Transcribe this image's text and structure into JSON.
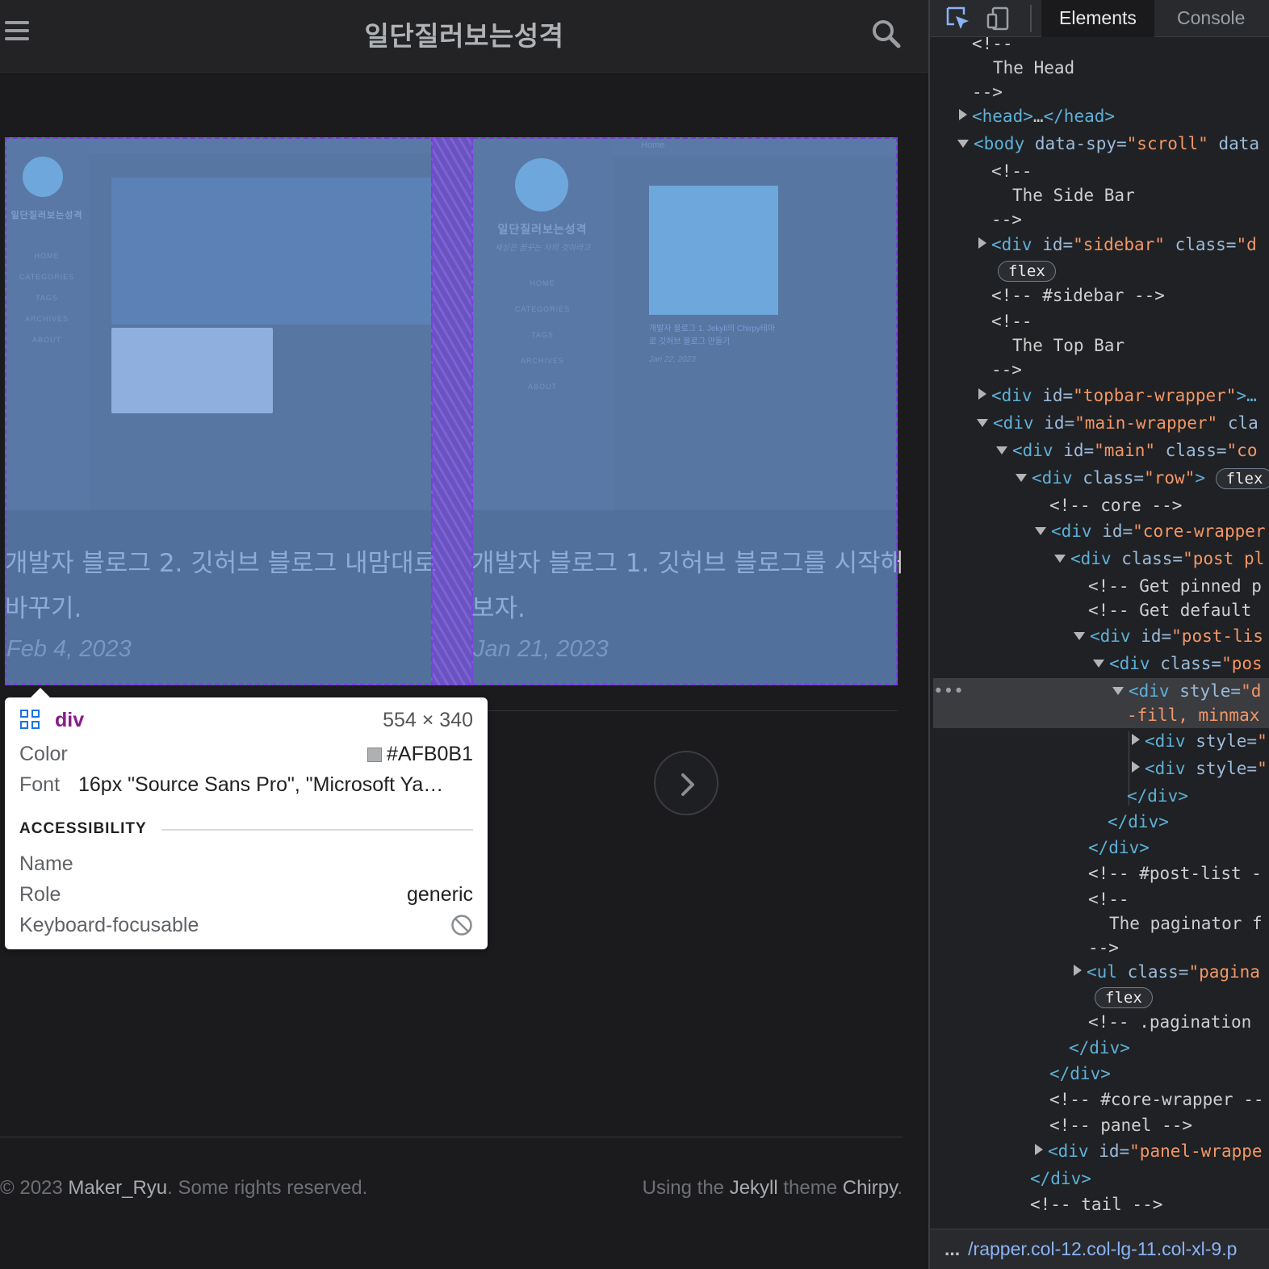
{
  "blog": {
    "site_title": "일단질러보는성격",
    "mini_site_title": "일단질러보는성격",
    "mini_subtitle": "세상은 꿈꾸는 자의 것이라고",
    "mini_nav": [
      "HOME",
      "CATEGORIES",
      "TAGS",
      "ARCHIVES",
      "ABOUT"
    ],
    "mini_home_bar": "Home",
    "mini_post_title": "개발자 블로그 1. Jekyll의 Chirpy테마로 깃허브 블로그 만들기",
    "mini_post_date": "Jan 22, 2023",
    "posts": [
      {
        "title": "개발자 블로그 2. 깃허브 블로그 내맘대로 바꾸기.",
        "date": "Feb 4, 2023"
      },
      {
        "title": "개발자 블로그 1. 깃허브 블로그를 시작해보자.",
        "date": "Jan 21, 2023"
      }
    ],
    "footer": {
      "copyright": "© 2023 ",
      "author": "Maker_Ryu",
      "rights": ". Some rights reserved.",
      "using_prefix": "Using the ",
      "jekyll": "Jekyll",
      "theme_word": " theme ",
      "chirpy": "Chirpy",
      "period": "."
    }
  },
  "tooltip": {
    "tag": "div",
    "dimensions": "554 × 340",
    "color_label": "Color",
    "color_value": "#AFB0B1",
    "font_label": "Font",
    "font_value": "16px \"Source Sans Pro\", \"Microsoft Ya…",
    "accessibility_header": "ACCESSIBILITY",
    "name_label": "Name",
    "role_label": "Role",
    "role_value": "generic",
    "focusable_label": "Keyboard-focusable"
  },
  "devtools": {
    "tabs": [
      "Elements",
      "Console"
    ],
    "active_tab": "Elements",
    "breadcrumb": "/rapper.col-12.col-lg-11.col-xl-9.p",
    "lines": {
      "l0": "<!--",
      "l1": "The Head",
      "l2": "-->",
      "head_tag": "<head>",
      "head_dots": "…",
      "head_close": "</head>",
      "body_tag": "<body",
      "body_attr1": " data-spy=",
      "body_val1": "\"scroll\"",
      "body_attr2": " data",
      "c_open": "<!--",
      "side_bar": "The Side Bar",
      "c_close": "-->",
      "sidebar_div": "<div",
      "sidebar_id": " id=",
      "sidebar_id_val": "\"sidebar\"",
      "sidebar_class": " class=",
      "sidebar_class_val": "\"d",
      "flex": "flex",
      "sidebar_end": "<!-- #sidebar -->",
      "top_bar": "The Top Bar",
      "topbar_div": "<div",
      "topbar_id": " id=",
      "topbar_val": "\"topbar-wrapper\"",
      "topbar_end": ">…",
      "main_wrapper_div": "<div",
      "main_wrapper_id": " id=",
      "main_wrapper_val": "\"main-wrapper\"",
      "main_wrapper_cls": " cla",
      "main_div": "<div",
      "main_id": " id=",
      "main_val": "\"main\"",
      "main_cls": " class=",
      "main_cls_val": "\"co",
      "row_div": "<div",
      "row_cls": " class=",
      "row_val": "\"row\"",
      "row_end": ">",
      "core_comment": "<!-- core -->",
      "core_div": "<div",
      "core_id": " id=",
      "core_val": "\"core-wrapper",
      "post_div": "<div",
      "post_cls": " class=",
      "post_val": "\"post pl",
      "pinned": "<!-- Get pinned p",
      "default": "<!-- Get default ",
      "postlist_div": "<div",
      "postlist_id": " id=",
      "postlist_val": "\"post-lis",
      "pos_div": "<div",
      "pos_cls": " class=",
      "pos_val": "\"pos",
      "sel_div": "<div",
      "sel_style": " style=",
      "sel_val": "\"d",
      "sel_cont": "-fill, minmax",
      "child1_div": "<div",
      "child1_style": " style=",
      "child1_val": "\"",
      "child2_div": "<div",
      "child2_style": " style=",
      "child2_val": "\"",
      "close_div": "</div>",
      "postlist_end": "<!-- #post-list -",
      "paginator": "The paginator f",
      "ul_tag": "<ul",
      "ul_cls": " class=",
      "ul_val": "\"pagina",
      "pagination_end": "<!-- .pagination ",
      "core_end": "<!-- #core-wrapper --",
      "panel_comment": "<!-- panel -->",
      "panel_div": "<div",
      "panel_id": " id=",
      "panel_val": "\"panel-wrappe",
      "tail": "<!-- tail -->",
      "dots": "..."
    }
  },
  "colors": {
    "overlay": "#6F9DDD",
    "margin_hatch": "#7A3EE0",
    "tooltip_tag": "#8A1B8A",
    "devtools_tag": "#5DB0D7",
    "devtools_value": "#F29766"
  },
  "icons": [
    "hamburger-icon",
    "search-icon",
    "chevron-right-icon",
    "inspect-element-icon",
    "device-toolbar-icon",
    "grid-icon",
    "not-allowed-icon"
  ]
}
